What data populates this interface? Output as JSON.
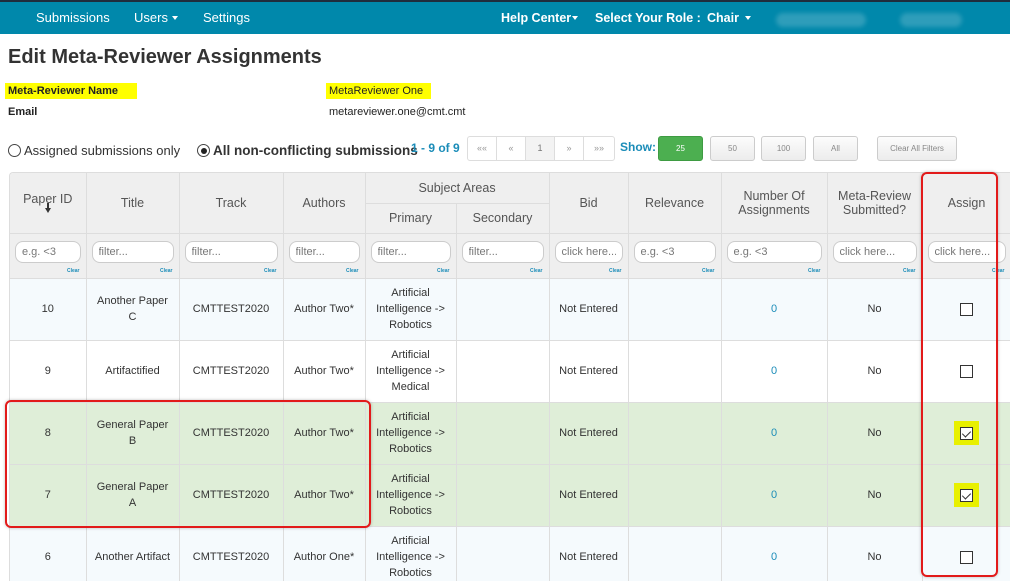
{
  "navbar": {
    "left": [
      {
        "label": "Submissions",
        "has_caret": false
      },
      {
        "label": "Users",
        "has_caret": true
      },
      {
        "label": "Settings",
        "has_caret": false
      }
    ],
    "help_center": "Help Center",
    "role_label": "Select Your Role :",
    "role_value": "Chair",
    "bg_color": "#0088ab"
  },
  "page": {
    "title": "Edit Meta-Reviewer Assignments",
    "name_label": "Meta-Reviewer Name",
    "name_value": "MetaReviewer One",
    "email_label": "Email",
    "email_value": "metareviewer.one@cmt.cmt"
  },
  "filters": {
    "radio_assigned": "Assigned submissions only",
    "radio_all": "All non-conflicting submissions",
    "selected": "all"
  },
  "pagination": {
    "count_text": "1 - 9 of 9",
    "first": "««",
    "prev": "«",
    "current": "1",
    "next": "»",
    "last": "»»",
    "show_label": "Show:",
    "page_sizes": [
      "25",
      "50",
      "100",
      "All"
    ],
    "selected_size": "25",
    "clear_all": "Clear All Filters"
  },
  "table": {
    "headers": {
      "paper_id": "Paper ID",
      "title": "Title",
      "track": "Track",
      "authors": "Authors",
      "subject_areas": "Subject Areas",
      "primary": "Primary",
      "secondary": "Secondary",
      "bid": "Bid",
      "relevance": "Relevance",
      "num_assignments": "Number Of Assignments",
      "meta_review_submitted": "Meta-Review Submitted?",
      "assign": "Assign"
    },
    "filter_placeholders": {
      "paper_id": "e.g. <3",
      "title": "filter...",
      "track": "filter...",
      "authors": "filter...",
      "primary": "filter...",
      "secondary": "filter...",
      "bid": "click here...",
      "relevance": "e.g. <3",
      "num_assignments": "e.g. <3",
      "meta_review_submitted": "click here...",
      "assign": "click here..."
    },
    "clear_label": "Clear",
    "rows": [
      {
        "id": "10",
        "title_line1": "Another Paper",
        "title_line2": "C",
        "track": "CMTTEST2020",
        "authors": "Author Two*",
        "primary_l1": "Artificial",
        "primary_l2": "Intelligence ->",
        "primary_l3": "Robotics",
        "secondary": "",
        "bid": "Not Entered",
        "relevance": "",
        "num_assignments": "0",
        "submitted": "No",
        "assigned": false,
        "style": "blue"
      },
      {
        "id": "9",
        "title_line1": "Artifactified",
        "title_line2": "",
        "track": "CMTTEST2020",
        "authors": "Author Two*",
        "primary_l1": "Artificial",
        "primary_l2": "Intelligence ->",
        "primary_l3": "Medical",
        "secondary": "",
        "bid": "Not Entered",
        "relevance": "",
        "num_assignments": "0",
        "submitted": "No",
        "assigned": false,
        "style": "white"
      },
      {
        "id": "8",
        "title_line1": "General Paper",
        "title_line2": "B",
        "track": "CMTTEST2020",
        "authors": "Author Two*",
        "primary_l1": "Artificial",
        "primary_l2": "Intelligence ->",
        "primary_l3": "Robotics",
        "secondary": "",
        "bid": "Not Entered",
        "relevance": "",
        "num_assignments": "0",
        "submitted": "No",
        "assigned": true,
        "style": "green"
      },
      {
        "id": "7",
        "title_line1": "General Paper",
        "title_line2": "A",
        "track": "CMTTEST2020",
        "authors": "Author Two*",
        "primary_l1": "Artificial",
        "primary_l2": "Intelligence ->",
        "primary_l3": "Robotics",
        "secondary": "",
        "bid": "Not Entered",
        "relevance": "",
        "num_assignments": "0",
        "submitted": "No",
        "assigned": true,
        "style": "green"
      },
      {
        "id": "6",
        "title_line1": "Another Artifact",
        "title_line2": "",
        "track": "CMTTEST2020",
        "authors": "Author One*",
        "primary_l1": "Artificial",
        "primary_l2": "Intelligence ->",
        "primary_l3": "Robotics",
        "secondary": "",
        "bid": "Not Entered",
        "relevance": "",
        "num_assignments": "0",
        "submitted": "No",
        "assigned": false,
        "style": "blue"
      }
    ]
  },
  "colors": {
    "accent_blue": "#1a8cb8",
    "highlight_yellow": "#ffff00",
    "annotation_red": "#e21a1a",
    "assigned_row_green": "#dfeed8",
    "show_25_green": "#4caf50"
  }
}
